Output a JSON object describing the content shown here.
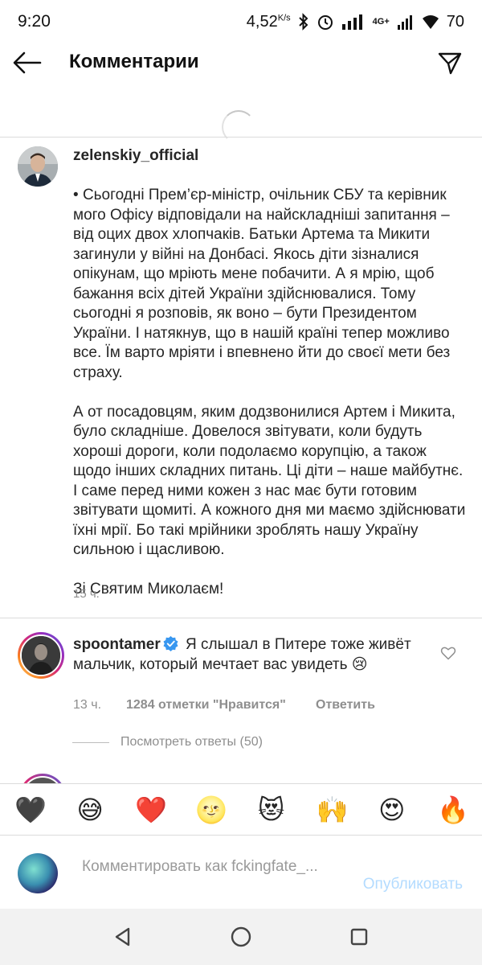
{
  "status_bar": {
    "time": "9:20",
    "speed": "4,52",
    "speed_unit": "K/s",
    "network": "4G+",
    "battery": "70"
  },
  "header": {
    "title": "Комментарии",
    "back_icon": "arrow-left-icon",
    "send_icon": "paper-plane-icon"
  },
  "caption": {
    "username": "zelenskiy_official",
    "paragraphs": [
      "Сьогодні Прем’єр-міністр, очільник СБУ та керівник мого Офісу відповідали на найскладніші запитання – від оцих двох хлопчаків. Батьки Артема та Микити загинули у війні на Донбасі. Якось діти зізналися опікунам, що мріють мене побачити. А я мрію, щоб бажання всіх дітей України здійснювалися. Тому сьогодні я розповів, як воно – бути Президентом України. І натякнув, що в нашій країні тепер можливо все. Їм варто мріяти і впевнено йти до своєї мети без страху.",
      "А от посадовцям, яким додзвонилися Артем і Микита, було складніше. Довелося звітувати, коли будуть хороші дороги, коли подолаємо корупцію, а також щодо інших складних питань. Ці діти – наше майбутнє. І саме перед ними кожен з нас має бути готовим звітувати щомиті. А кожного дня ми маємо здійснювати їхні мрії. Бо такі мрійники зроблять нашу Україну сильною і щасливою.",
      "Зі Святим Миколаєм!"
    ],
    "time": "15 ч."
  },
  "comment": {
    "username": "spoontamer",
    "text": "Я слышал в Питере тоже живёт мальчик, который мечтает вас увидеть",
    "emoji": "😢",
    "time": "13 ч.",
    "likes": "1284 отметки \"Нравится\"",
    "reply": "Ответить",
    "view_replies": "Посмотреть ответы (50)"
  },
  "emoji_bar": [
    "🖤",
    "😅",
    "❤️",
    "🌝",
    "😻",
    "🙌",
    "😍",
    "🔥"
  ],
  "input": {
    "placeholder": "Комментировать как fckingfate_...",
    "post_label": "Опубликовать"
  },
  "colors": {
    "text": "#262626",
    "secondary": "#8e8e8e",
    "link_disabled": "#b3dbff",
    "verified": "#3897f0"
  }
}
